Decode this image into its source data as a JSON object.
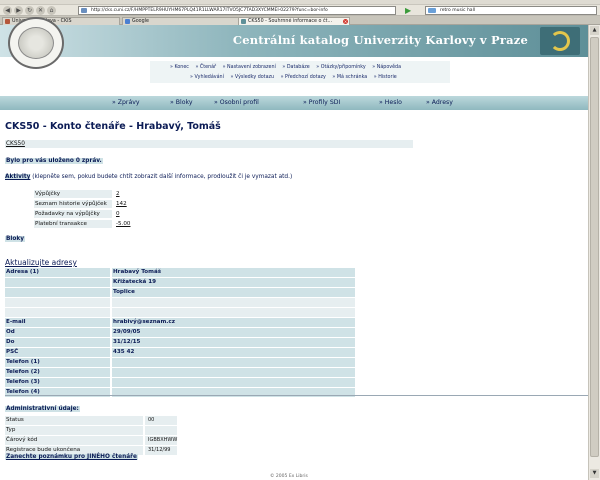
{
  "browser": {
    "url": "http://cks.cuni.cz/F/HMPPTELR9HUYHM67PLQ41R1LLWAR17ITVO5JC7TAD3XYCMMEI-02279?func=bor-info",
    "search_value": "retro music hall",
    "tabs": [
      {
        "label": "Univerzita Karlova - CKIS",
        "active": false
      },
      {
        "label": "Google",
        "active": false
      },
      {
        "label": "CKS50 - Souhrnné informace o čt...",
        "active": true
      }
    ]
  },
  "header": {
    "title": "Centrální katalog Univerzity  Karlovy v Praze",
    "menu_row1": [
      "» Konec",
      "» Čtenář",
      "» Nastavení zobrazení",
      "» Databáze",
      "» Otázky/připomínky",
      "» Nápověda"
    ],
    "menu_row2": [
      "» Vyhledávání",
      "» Výsledky dotazu",
      "» Předchozí dotazy",
      "» Má schránka",
      "» Historie"
    ]
  },
  "nav2": [
    "» Zprávy",
    "» Bloky",
    "» Osobní profil",
    "» Profily SDI",
    "» Heslo",
    "» Adresy"
  ],
  "page": {
    "title": "CKS50 - Konto čtenáře - Hrabavý, Tomáš",
    "cks_link": "CKS50",
    "messages": "Bylo pro vás uloženo 0 zpráv.",
    "activity_label": "Aktivity",
    "activity_hint": "(klepněte sem, pokud budete chtít zobrazit další informace, prodloužit či je vymazat atd.)",
    "activity_rows": [
      {
        "label": "Výpůjčky",
        "value": "2"
      },
      {
        "label": "Seznam historie výpůjček",
        "value": "142"
      },
      {
        "label": "Požadavky na výpůjčky",
        "value": "0"
      },
      {
        "label": "Platební transakce",
        "value": "-5.00"
      }
    ],
    "bloky": "Bloky",
    "update_title": "Aktualizujte adresy",
    "address_rows": [
      {
        "label": "Adresa (1)",
        "value": "Hrabavý Tomáš"
      },
      {
        "label": "",
        "value": "Křižatecká 19"
      },
      {
        "label": "",
        "value": "Toplice"
      },
      {
        "label": "",
        "value": ""
      },
      {
        "label": "",
        "value": ""
      },
      {
        "label": "E-mail",
        "value": "hrabivý@seznam.cz"
      },
      {
        "label": "Od",
        "value": "29/09/05"
      },
      {
        "label": "Do",
        "value": "31/12/15"
      },
      {
        "label": "PSČ",
        "value": "435 42"
      },
      {
        "label": "Telefon (1)",
        "value": ""
      },
      {
        "label": "Telefon (2)",
        "value": ""
      },
      {
        "label": "Telefon (3)",
        "value": ""
      },
      {
        "label": "Telefon (4)",
        "value": ""
      }
    ],
    "admin_title": "Administrativní údaje:",
    "admin_rows": [
      {
        "label": "Status",
        "value": "00"
      },
      {
        "label": "Typ",
        "value": ""
      },
      {
        "label": "Čárový kód",
        "value": "IGBBXHWW"
      },
      {
        "label": "Registrace bude ukončena",
        "value": "31/12/99"
      }
    ],
    "note_link": "Zanechte poznámku pro JINÉHO čtenáře",
    "footer": "© 2005 Ex Libris"
  },
  "colors": {
    "banner_start": "#cfe2e6",
    "banner_end": "#5e8f98",
    "label_bg": "#cfe2e6",
    "text_navy": "#0b1b55"
  }
}
